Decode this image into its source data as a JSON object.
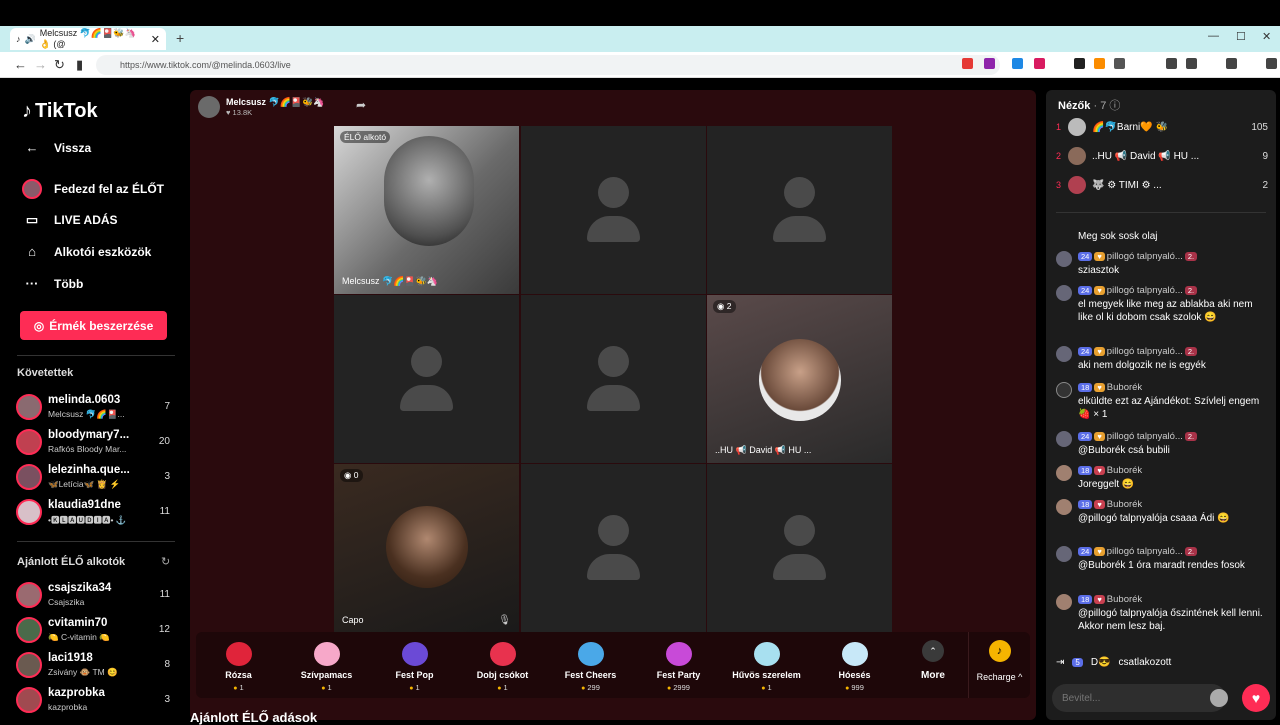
{
  "browser": {
    "tab_title": "Melcsusz 🐬🌈🎴🐝🦄👌 (@",
    "url": "https://www.tiktok.com/@melinda.0603/live",
    "new_tab": "+",
    "close": "✕"
  },
  "sidebar": {
    "logo": "TikTok",
    "back": "Vissza",
    "nav": [
      {
        "label": "Fedezd fel az ÉLŐT",
        "icon": "avatar-icon"
      },
      {
        "label": "LIVE ADÁS",
        "icon": "live-camera-icon"
      },
      {
        "label": "Alkotói eszközök",
        "icon": "creator-tools-icon"
      },
      {
        "label": "Több",
        "icon": "more-dots-icon"
      }
    ],
    "coins_button": "Érmék beszerzése",
    "following_title": "Követettek",
    "following": [
      {
        "name": "melinda.0603",
        "sub": "Melcsusz 🐬🌈🎴...",
        "count": "7"
      },
      {
        "name": "bloodymary7...",
        "sub": "Rafkós Bloody Mar...",
        "count": "20"
      },
      {
        "name": "lelezinha.que...",
        "sub": "🦋Letícia🦋 👸 ⚡",
        "count": "3"
      },
      {
        "name": "klaudia91dne",
        "sub": "•🅺🅻🅰🆄🅳🅸🅰• ⚓",
        "count": "11"
      }
    ],
    "recommended_title": "Ajánlott ÉLŐ alkotók",
    "recommended": [
      {
        "name": "csajszika34",
        "sub": "Csajszika",
        "count": "11"
      },
      {
        "name": "cvitamin70",
        "sub": "🍋 C-vitamin 🍋",
        "count": "12"
      },
      {
        "name": "laci1918",
        "sub": "Zsivány 🐵 TM 😊",
        "count": "8"
      },
      {
        "name": "kazprobka",
        "sub": "kazprobka",
        "count": "3"
      }
    ]
  },
  "stream": {
    "host_name": "Melcsusz 🐬🌈🎴🐝🦄",
    "host_likes": "♥ 13.8K",
    "host_badge": "ÉLŐ alkotó",
    "host_cell_name": "Melcsusz 🐬🌈🎴🐝🦄",
    "david_count": "2",
    "david_name": "..HU 📢 David 📢 HU ...",
    "capo_count": "0",
    "capo_name": "Capo",
    "recommended_heading": "Ajánlott ÉLŐ adások"
  },
  "gifts": [
    {
      "name": "Rózsa",
      "price": "1",
      "color": "#e0243a"
    },
    {
      "name": "Szívpamacs",
      "price": "1",
      "color": "#f7a8c9"
    },
    {
      "name": "Fest Pop",
      "price": "1",
      "color": "#6b4ad6"
    },
    {
      "name": "Dobj csókot",
      "price": "1",
      "color": "#e8324e"
    },
    {
      "name": "Fest Cheers",
      "price": "299",
      "color": "#4aa8e8"
    },
    {
      "name": "Fest Party",
      "price": "2999",
      "color": "#c84ad8"
    },
    {
      "name": "Hűvös szerelem",
      "price": "1",
      "color": "#a8e0f0"
    },
    {
      "name": "Hóesés",
      "price": "999",
      "color": "#c8e8f8"
    }
  ],
  "more_label": "More",
  "recharge_label": "Recharge ^",
  "viewers": {
    "title": "Nézők",
    "count": "· 7",
    "list": [
      {
        "rank": "1",
        "name": "🌈🐬Barni🧡 🐝",
        "score": "105"
      },
      {
        "rank": "2",
        "name": "..HU 📢 David 📢 HU ...",
        "score": "9"
      },
      {
        "rank": "3",
        "name": "🐺 ⚙ TIMI ⚙ ...",
        "score": "2"
      }
    ]
  },
  "chat": [
    {
      "user": "",
      "level": "",
      "text": "Meg sok sosk olaj",
      "rank": ""
    },
    {
      "user": "pillogó talpnyaló...",
      "level": "24",
      "text": "sziasztok",
      "rank": "2."
    },
    {
      "user": "pillogó talpnyaló...",
      "level": "24",
      "text": "el megyek like meg az ablakba aki nem like ol ki dobom csak szolok 😄",
      "rank": "2."
    },
    {
      "user": "pillogó talpnyaló...",
      "level": "24",
      "text": "aki nem dolgozik ne is egyék",
      "rank": "2."
    },
    {
      "user": "Buborék",
      "level": "18",
      "text": "elküldte ezt az Ajándékot: Szívlelj engem 🍓 × 1",
      "rank": ""
    },
    {
      "user": "pillogó talpnyaló...",
      "level": "24",
      "text": "@Buborék csá bubili",
      "rank": "2."
    },
    {
      "user": "Buborék",
      "level": "18",
      "text": "Joreggelt 😄",
      "rank": ""
    },
    {
      "user": "Buborék",
      "level": "18",
      "text": "@pillogó talpnyalója csaaa Ádi 😄",
      "rank": ""
    },
    {
      "user": "pillogó talpnyaló...",
      "level": "24",
      "text": "@Buborék 1 óra maradt rendes fosok",
      "rank": "2."
    },
    {
      "user": "Buborék",
      "level": "18",
      "text": "@pillogó talpnyalója őszintének kell lenni. Akkor nem lesz baj.",
      "rank": ""
    }
  ],
  "joined": {
    "level": "5",
    "name": "D😎",
    "text": "csatlakozott"
  },
  "chat_input": {
    "placeholder": "Bevitel..."
  }
}
